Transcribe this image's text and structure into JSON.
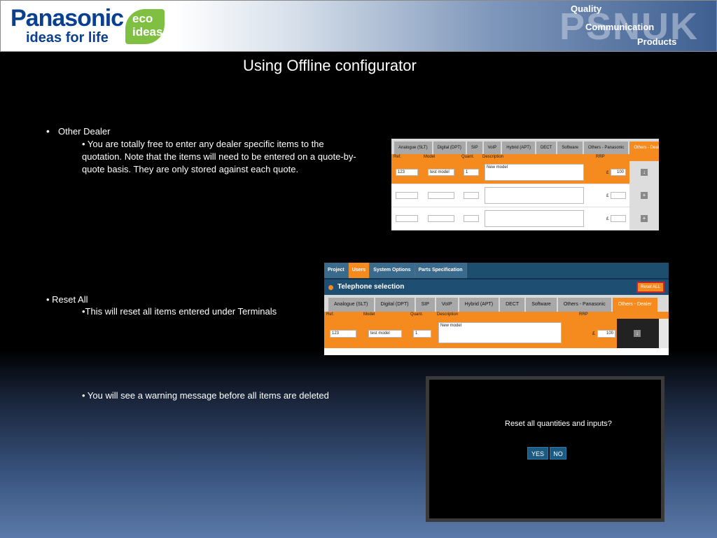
{
  "banner": {
    "brand": "Panasonic",
    "tagline": "ideas for life",
    "eco_line1": "eco",
    "eco_line2": "ideas",
    "psnuk": "PSNUK",
    "quality": "Quality",
    "communication": "Communication",
    "products": "Products"
  },
  "title": "Using Offline configurator",
  "section1": {
    "bullet": "•",
    "heading": "Other Dealer",
    "body_l1": "• You are totally free to enter any dealer specific items to the",
    "body_l2": "quotation. Note that the items will need to be entered on a quote-by-",
    "body_l3": "quote basis. They are only stored against each quote."
  },
  "section2": {
    "heading": "• Reset All",
    "body": "•This will reset all items entered under Terminals"
  },
  "section3": {
    "body": "• You will see a warning message before all items are deleted"
  },
  "shot1": {
    "tabs": [
      "Analogue (SLT)",
      "Digital (DPT)",
      "SIP",
      "VoIP",
      "Hybrid (APT)",
      "DECT",
      "Software",
      "Others - Panasonic",
      "Others - Dealer"
    ],
    "cols": {
      "ref": "Ref.",
      "model": "Model",
      "quant": "Quant.",
      "desc": "Description",
      "rrp": "RRP"
    },
    "row1": {
      "ref": "123",
      "model": "test model",
      "quant": "1",
      "desc": "New model",
      "currency": "£",
      "price": "100"
    }
  },
  "shot2": {
    "nav": [
      "Project",
      "Users",
      "System Options",
      "Parts Specification"
    ],
    "heading": "Telephone selection",
    "reset": "Reset ALL",
    "tabs": [
      "Analogue (SLT)",
      "Digital (DPT)",
      "SIP",
      "VoIP",
      "Hybrid (APT)",
      "DECT",
      "Software",
      "Others - Panasonic",
      "Others - Dealer"
    ],
    "cols": {
      "ref": "Ref.",
      "model": "Model",
      "quant": "Quant.",
      "desc": "Description",
      "rrp": "RRP"
    },
    "row1": {
      "ref": "123",
      "model": "test model",
      "quant": "1",
      "desc": "New model",
      "currency": "£",
      "price": "100"
    }
  },
  "shot3": {
    "question": "Reset all quantities and inputs?",
    "yes": "YES",
    "no": "NO"
  }
}
